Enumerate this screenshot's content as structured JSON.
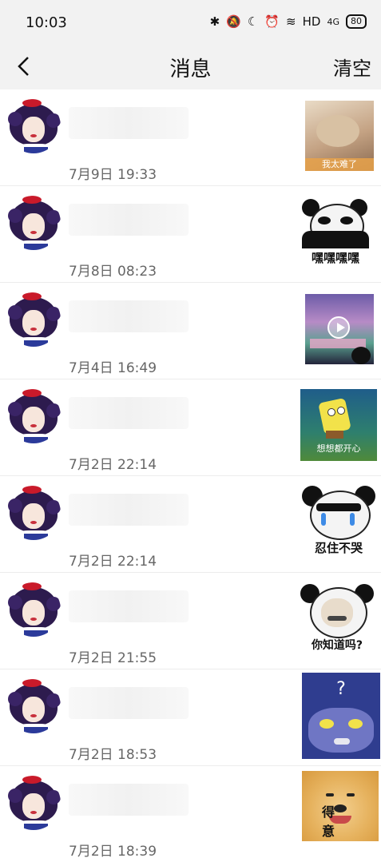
{
  "status_bar": {
    "time": "10:03",
    "icons": [
      "bluetooth-icon",
      "mute-icon",
      "moon-icon",
      "alarm-icon",
      "wifi-icon"
    ],
    "hd": "HD",
    "signal": "4G",
    "battery": "80"
  },
  "nav": {
    "title": "消息",
    "clear_label": "清空"
  },
  "messages": [
    {
      "timestamp": "7月9日 19:33",
      "thumb_caption": "我太难了"
    },
    {
      "timestamp": "7月8日 08:23",
      "thumb_caption": "嘿嘿嘿嘿"
    },
    {
      "timestamp": "7月4日 16:49",
      "thumb_caption": ""
    },
    {
      "timestamp": "7月2日 22:14",
      "thumb_caption": "想想都开心"
    },
    {
      "timestamp": "7月2日 22:14",
      "thumb_caption": "忍住不哭"
    },
    {
      "timestamp": "7月2日 21:55",
      "thumb_caption": "你知道吗?"
    },
    {
      "timestamp": "7月2日 18:53",
      "thumb_caption": "?"
    },
    {
      "timestamp": "7月2日 18:39",
      "thumb_caption": "得 意"
    }
  ]
}
